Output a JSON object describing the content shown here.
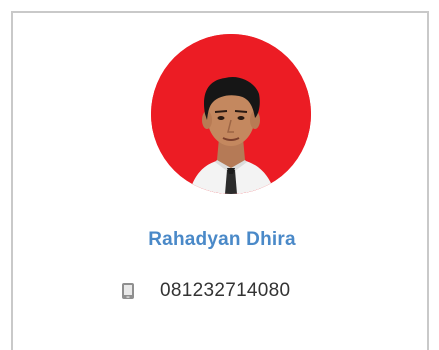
{
  "profile": {
    "name": "Rahadyan Dhira",
    "phone": "081232714080",
    "photo_icon": "user-photo",
    "phone_icon": "mobile-phone-icon"
  },
  "colors": {
    "avatar_background": "#ec1c24",
    "name_color": "#4a89c8",
    "border": "#c9c9c9"
  }
}
